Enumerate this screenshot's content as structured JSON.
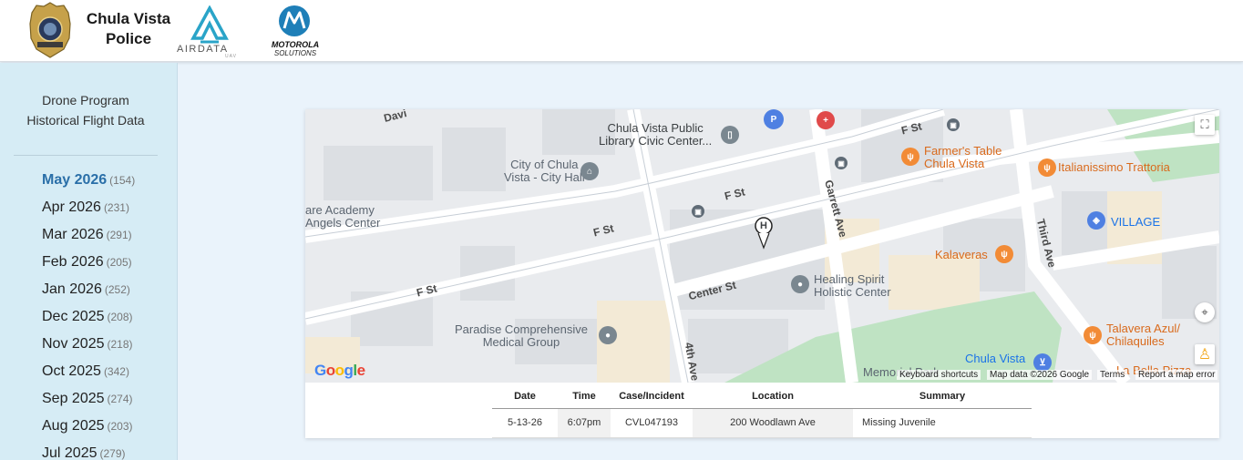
{
  "header": {
    "agency_name": "Chula Vista Police",
    "airdata_logo": "AIRDATA",
    "airdata_sub": "UAV",
    "motorola_logo": "MOTOROLA",
    "motorola_sub": "SOLUTIONS"
  },
  "sidebar": {
    "title_line1": "Drone Program",
    "title_line2": "Historical Flight Data",
    "months": [
      {
        "label": "May 2026",
        "count": "(154)",
        "active": true
      },
      {
        "label": "Apr 2026",
        "count": "(231)"
      },
      {
        "label": "Mar 2026",
        "count": "(291)"
      },
      {
        "label": "Feb 2026",
        "count": "(205)"
      },
      {
        "label": "Jan 2026",
        "count": "(252)"
      },
      {
        "label": "Dec 2025",
        "count": "(208)"
      },
      {
        "label": "Nov 2025",
        "count": "(218)"
      },
      {
        "label": "Oct 2025",
        "count": "(342)"
      },
      {
        "label": "Sep 2025",
        "count": "(274)"
      },
      {
        "label": "Aug 2025",
        "count": "(203)"
      },
      {
        "label": "Jul 2025",
        "count": "(279)"
      }
    ]
  },
  "map": {
    "labels": {
      "library": "Chula Vista Public\nLibrary Civic Center...",
      "city_hall": "City of Chula\nVista - City Hall",
      "academy": "are Academy\nAngels Center",
      "healing": "Healing Spirit\nHolistic Center",
      "paradise": "Paradise Comprehensive\nMedical Group",
      "farmers": "Farmer's Table\nChula Vista",
      "italianissimo": "Italianissimo Trattoria",
      "village": "VILLAGE",
      "kalaveras": "Kalaveras",
      "talavera": "Talavera Azul/\nChilaquiles",
      "chula_vista": "Chula Vista",
      "bella": "La Bella Pizza",
      "memorial": "Memorial Park"
    },
    "streets": {
      "f_st_1": "F St",
      "f_st_2": "F St",
      "f_st_3": "F St",
      "f_st_4": "F St",
      "center": "Center St",
      "garrett": "Garrett Ave",
      "fourth": "4th Ave",
      "third": "Third Ave",
      "davidson": "Davi"
    },
    "helipad": "H",
    "google": "Google",
    "keyboard": "Keyboard shortcuts",
    "map_data": "Map data ©2026 Google",
    "terms": "Terms",
    "report": "Report a map error",
    "icons": {
      "fullscreen": "fullscreen-icon",
      "locate": "locate-icon",
      "pegman": "pegman-icon"
    }
  },
  "table": {
    "headers": [
      "Date",
      "Time",
      "Case/Incident",
      "Location",
      "Summary"
    ],
    "rows": [
      [
        "5-13-26",
        "6:07pm",
        "CVL047193",
        "200 Woodlawn Ave",
        "Missing Juvenile"
      ]
    ]
  },
  "colors": {
    "accent": "#2a6fa8",
    "sidebar_bg": "#d6ecf5",
    "page_bg": "#eaf3fb",
    "poi_orange": "#e8710a",
    "park_green": "#bfe3c3"
  }
}
